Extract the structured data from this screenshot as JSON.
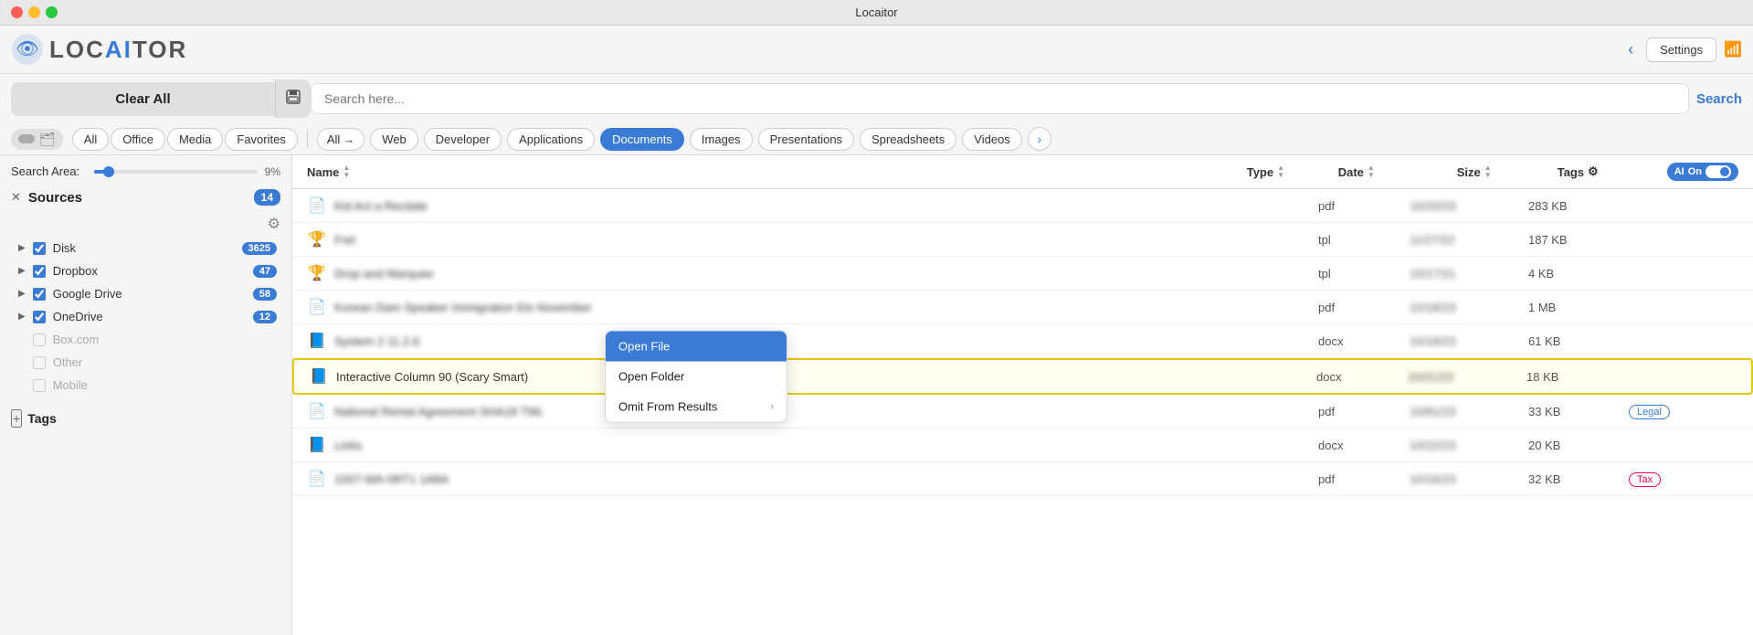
{
  "titlebar": {
    "title": "Locaitor"
  },
  "header": {
    "logo_text_loc": "LOC",
    "logo_text_ai": "AI",
    "logo_text_tor": "TOR",
    "settings_label": "Settings",
    "chevron": "‹"
  },
  "search": {
    "clear_all_label": "Clear All",
    "save_icon": "⊟",
    "placeholder": "Search here...",
    "button_label": "Search"
  },
  "filter_tabs_left": {
    "all": "All",
    "office": "Office",
    "media": "Media",
    "favorites": "Favorites"
  },
  "filter_tabs_right": {
    "all": "All",
    "web": "Web",
    "developer": "Developer",
    "applications": "Applications",
    "documents": "Documents",
    "images": "Images",
    "presentations": "Presentations",
    "spreadsheets": "Spreadsheets",
    "videos": "Videos"
  },
  "sidebar": {
    "search_area_label": "Search Area:",
    "search_area_pct": "9%",
    "sources_title": "Sources",
    "sources_count": "14",
    "sources": [
      {
        "label": "Disk",
        "count": "3625",
        "checked": true,
        "disabled": false
      },
      {
        "label": "Dropbox",
        "count": "47",
        "checked": true,
        "disabled": false
      },
      {
        "label": "Google Drive",
        "count": "58",
        "checked": true,
        "disabled": false
      },
      {
        "label": "OneDrive",
        "count": "12",
        "checked": true,
        "disabled": false
      },
      {
        "label": "Box.com",
        "count": "",
        "checked": false,
        "disabled": true
      },
      {
        "label": "Other",
        "count": "",
        "checked": false,
        "disabled": true
      },
      {
        "label": "Mobile",
        "count": "",
        "checked": false,
        "disabled": true
      }
    ],
    "tags_title": "Tags"
  },
  "columns": {
    "name": "Name",
    "type": "Type",
    "date": "Date",
    "size": "Size",
    "tags": "Tags"
  },
  "ai_toggle": {
    "label": "AI",
    "state": "On"
  },
  "files": [
    {
      "icon": "📄",
      "name": "Kid Act a Recitale",
      "name_blurred": true,
      "type": "pdf",
      "date": "10/20/23",
      "size": "283 KB",
      "tag": ""
    },
    {
      "icon": "🏆",
      "name": "Fret",
      "name_blurred": true,
      "type": "tpl",
      "date": "11/27/22",
      "size": "187 KB",
      "tag": ""
    },
    {
      "icon": "🏆",
      "name": "Drop and Marquee",
      "name_blurred": true,
      "type": "tpl",
      "date": "10/17/21",
      "size": "4 KB",
      "tag": ""
    },
    {
      "icon": "📄",
      "name": "Korean Dam Speaker Immigration Els November",
      "name_blurred": true,
      "type": "pdf",
      "date": "10/18/23",
      "size": "1 MB",
      "tag": ""
    },
    {
      "icon": "📘",
      "name": "System 2 11.2.6",
      "name_blurred": true,
      "type": "docx",
      "date": "10/18/23",
      "size": "61 KB",
      "tag": ""
    },
    {
      "icon": "📘",
      "name": "Interactive Column 90 (Scary Smart)",
      "name_blurred": false,
      "type": "docx",
      "date": "10/21/22",
      "size": "18 KB",
      "tag": "",
      "highlighted": true
    },
    {
      "icon": "📄",
      "name": "National Rental Agreement SHA18 TML",
      "name_blurred": true,
      "type": "pdf",
      "date": "10/81/23",
      "size": "33 KB",
      "tag": "Legal"
    },
    {
      "icon": "📘",
      "name": "Links",
      "name_blurred": true,
      "type": "docx",
      "date": "10/22/23",
      "size": "20 KB",
      "tag": ""
    },
    {
      "icon": "📄",
      "name": "1007-WA-0RT1 1A8A",
      "name_blurred": true,
      "type": "pdf",
      "date": "10/16/23",
      "size": "32 KB",
      "tag": "Tax"
    }
  ],
  "context_menu": {
    "open_file": "Open File",
    "open_folder": "Open Folder",
    "omit_from_results": "Omit From Results"
  }
}
